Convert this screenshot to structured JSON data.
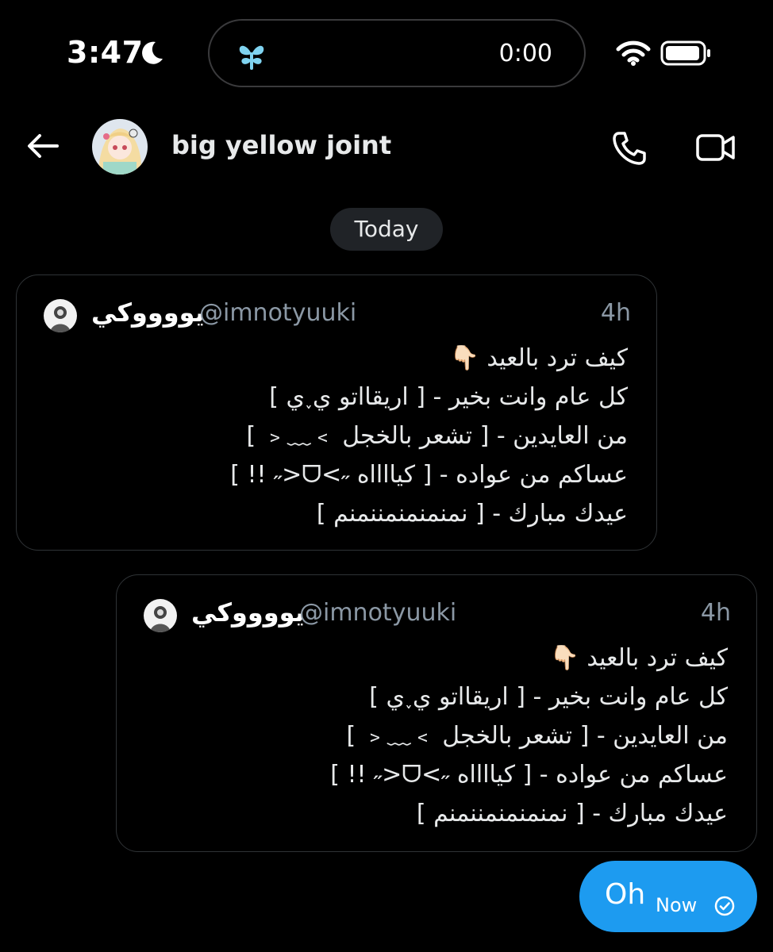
{
  "status_bar": {
    "time": "3:47",
    "island_time": "0:00"
  },
  "header": {
    "name": "big yellow joint"
  },
  "date_separator": "Today",
  "tweets": [
    {
      "name": "يووووكي",
      "handle": "@imnotyuuki",
      "time": "4h",
      "lines": [
        "كيف ترد بالعيد 👇🏻",
        "كل عام وانت بخير - [ اريقااتو ي˯ي ]",
        "من العايدين - [ تشعر بالخجل ﹥﹏﹤ ]",
        "عساكم من عواده - [ كيااااه ˶>ᗜ<˶ !! ]",
        "عيدك مبارك - [ نمنمنمنمننمنم ]"
      ]
    },
    {
      "name": "يووووكي",
      "handle": "@imnotyuuki",
      "time": "4h",
      "lines": [
        "كيف ترد بالعيد 👇🏻",
        "كل عام وانت بخير - [ اريقااتو ي˯ي ]",
        "من العايدين - [ تشعر بالخجل ﹥﹏﹤ ]",
        "عساكم من عواده - [ كيااااه ˶>ᗜ<˶ !! ]",
        "عيدك مبارك - [ نمنمنمنمننمنم ]"
      ]
    }
  ],
  "my_message": {
    "text": "Oh",
    "time": "Now"
  },
  "icons": {
    "moon": "moon-icon",
    "island": "sprout-icon",
    "wifi": "wifi-icon",
    "battery": "battery-icon",
    "back": "back-arrow-icon",
    "phone": "phone-icon",
    "video": "video-camera-icon",
    "read": "read-check-icon"
  },
  "colors": {
    "accent": "#1d9bf0",
    "background": "#000000",
    "muted": "#8b98a5",
    "border": "#2f3336"
  }
}
